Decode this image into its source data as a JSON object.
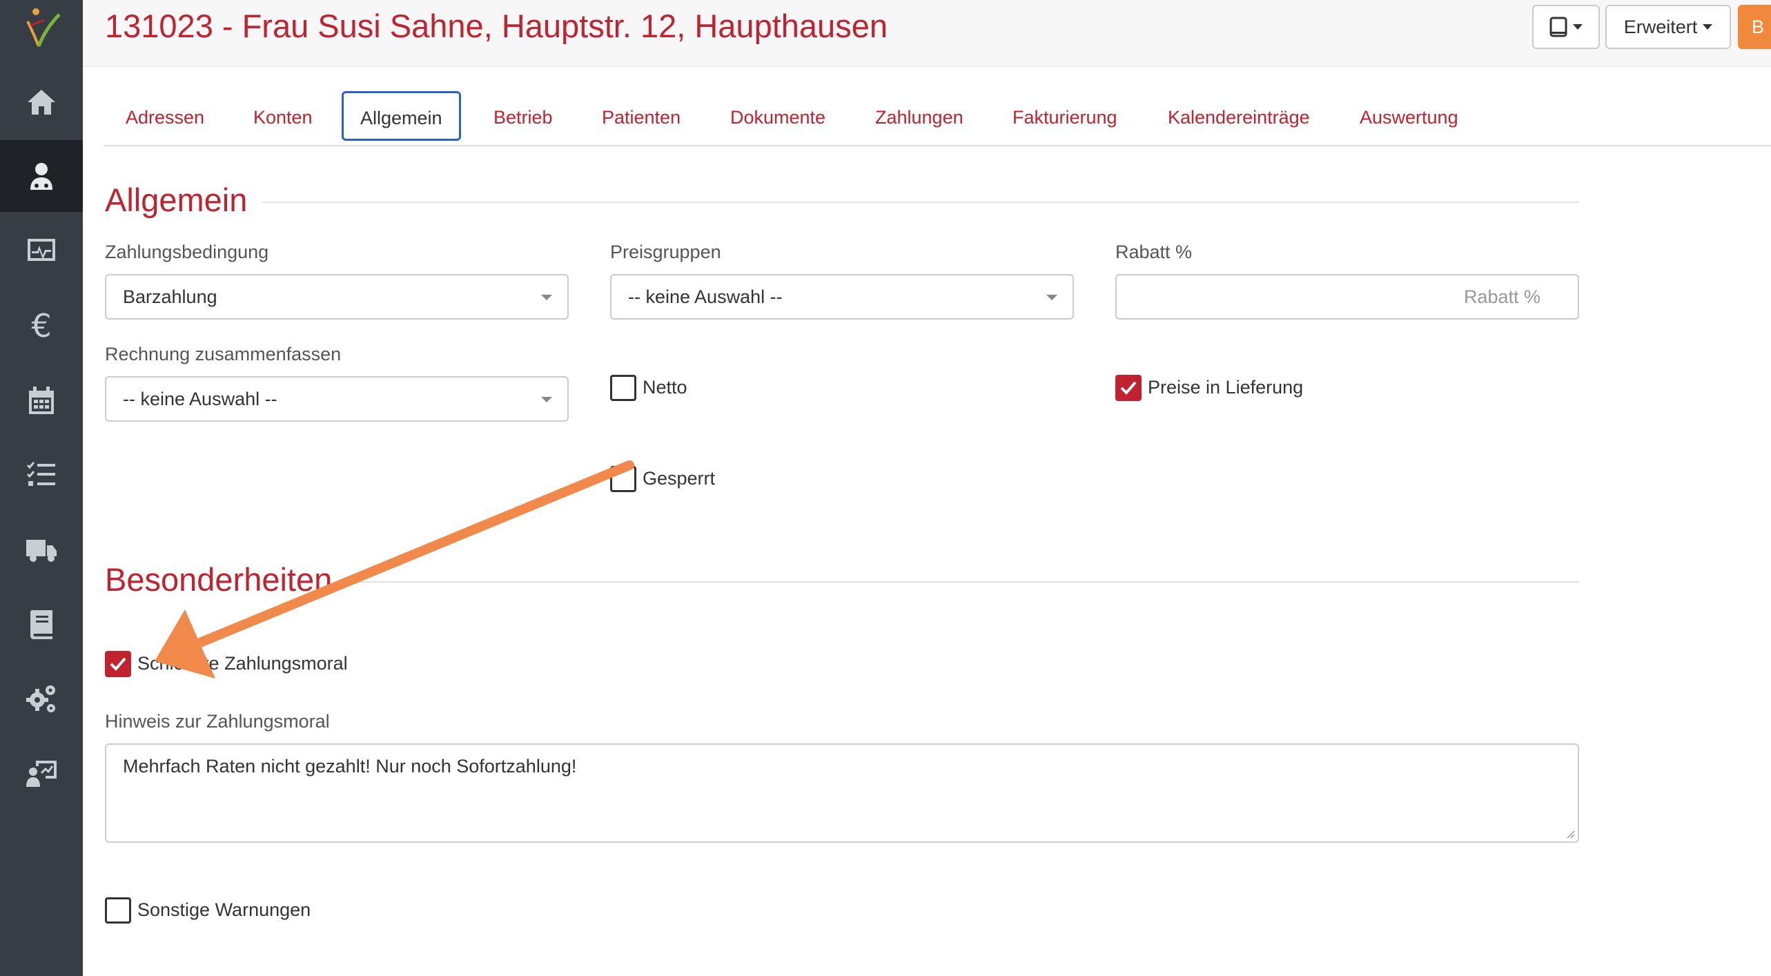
{
  "header": {
    "title": "131023 - Frau Susi Sahne, Hauptstr. 12, Haupthausen",
    "erweitert_label": "Erweitert",
    "orange_label": "B"
  },
  "sidebar": {
    "items": [
      {
        "icon": "home-icon"
      },
      {
        "icon": "customer-icon",
        "active": true
      },
      {
        "icon": "monitor-icon"
      },
      {
        "icon": "euro-icon"
      },
      {
        "icon": "calendar-icon"
      },
      {
        "icon": "checklist-icon"
      },
      {
        "icon": "truck-icon"
      },
      {
        "icon": "book-icon"
      },
      {
        "icon": "gears-icon"
      },
      {
        "icon": "presentation-icon"
      }
    ],
    "euro_glyph": "€"
  },
  "tabs": [
    "Adressen",
    "Konten",
    "Allgemein",
    "Betrieb",
    "Patienten",
    "Dokumente",
    "Zahlungen",
    "Fakturierung",
    "Kalendereinträge",
    "Auswertung"
  ],
  "active_tab": "Allgemein",
  "allgemein": {
    "title": "Allgemein",
    "zahlungsbedingung_label": "Zahlungsbedingung",
    "zahlungsbedingung_value": "Barzahlung",
    "preisgruppen_label": "Preisgruppen",
    "preisgruppen_value": "-- keine Auswahl --",
    "rabatt_label": "Rabatt %",
    "rabatt_placeholder": "Rabatt %",
    "rechnung_label": "Rechnung zusammenfassen",
    "rechnung_value": "-- keine Auswahl --",
    "netto_label": "Netto",
    "netto_checked": false,
    "preise_label": "Preise in Lieferung",
    "preise_checked": true,
    "gesperrt_label": "Gesperrt",
    "gesperrt_checked": false
  },
  "besonderheiten": {
    "title": "Besonderheiten",
    "schlechte_label": "Schlechte Zahlungsmoral",
    "schlechte_checked": true,
    "hinweis_label": "Hinweis zur Zahlungsmoral",
    "hinweis_value": "Mehrfach Raten nicht gezahlt! Nur noch Sofortzahlung!",
    "sonstige_label": "Sonstige Warnungen",
    "sonstige_checked": false
  },
  "colors": {
    "accent": "#c0232f",
    "sidebar": "#363d44",
    "annotation_arrow": "#f0894a",
    "active_tab_border": "#2a62c9"
  }
}
